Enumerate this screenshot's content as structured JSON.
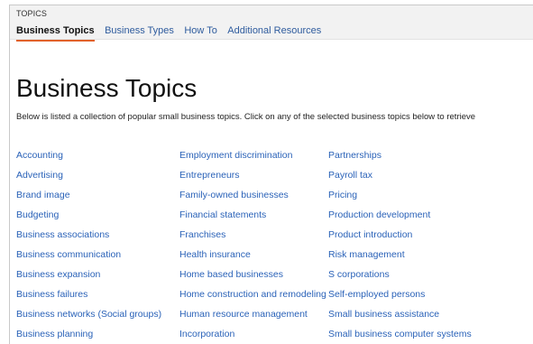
{
  "nav": {
    "header": "TOPICS",
    "tabs": [
      {
        "label": "Business Topics"
      },
      {
        "label": "Business Types"
      },
      {
        "label": "How To"
      },
      {
        "label": "Additional Resources"
      }
    ]
  },
  "main": {
    "title": "Business Topics",
    "intro": "Below is listed a collection of popular small business topics. Click on any of the selected business topics below to retrieve",
    "columns": [
      [
        "Accounting",
        "Advertising",
        "Brand image",
        "Budgeting",
        "Business associations",
        "Business communication",
        "Business expansion",
        "Business failures",
        "Business networks (Social groups)",
        "Business planning"
      ],
      [
        "Employment discrimination",
        "Entrepreneurs",
        "Family-owned businesses",
        "Financial statements",
        "Franchises",
        "Health insurance",
        "Home based businesses",
        "Home construction and remodeling",
        "Human resource management",
        "Incorporation"
      ],
      [
        "Partnerships",
        "Payroll tax",
        "Pricing",
        "Production development",
        "Product introduction",
        "Risk management",
        "S corporations",
        "Self-employed persons",
        "Small business assistance",
        "Small business computer systems"
      ]
    ]
  },
  "colors": {
    "link": "#2a62b8",
    "active_underline": "#e1612a",
    "navbar_bg": "#f2f2f2"
  }
}
